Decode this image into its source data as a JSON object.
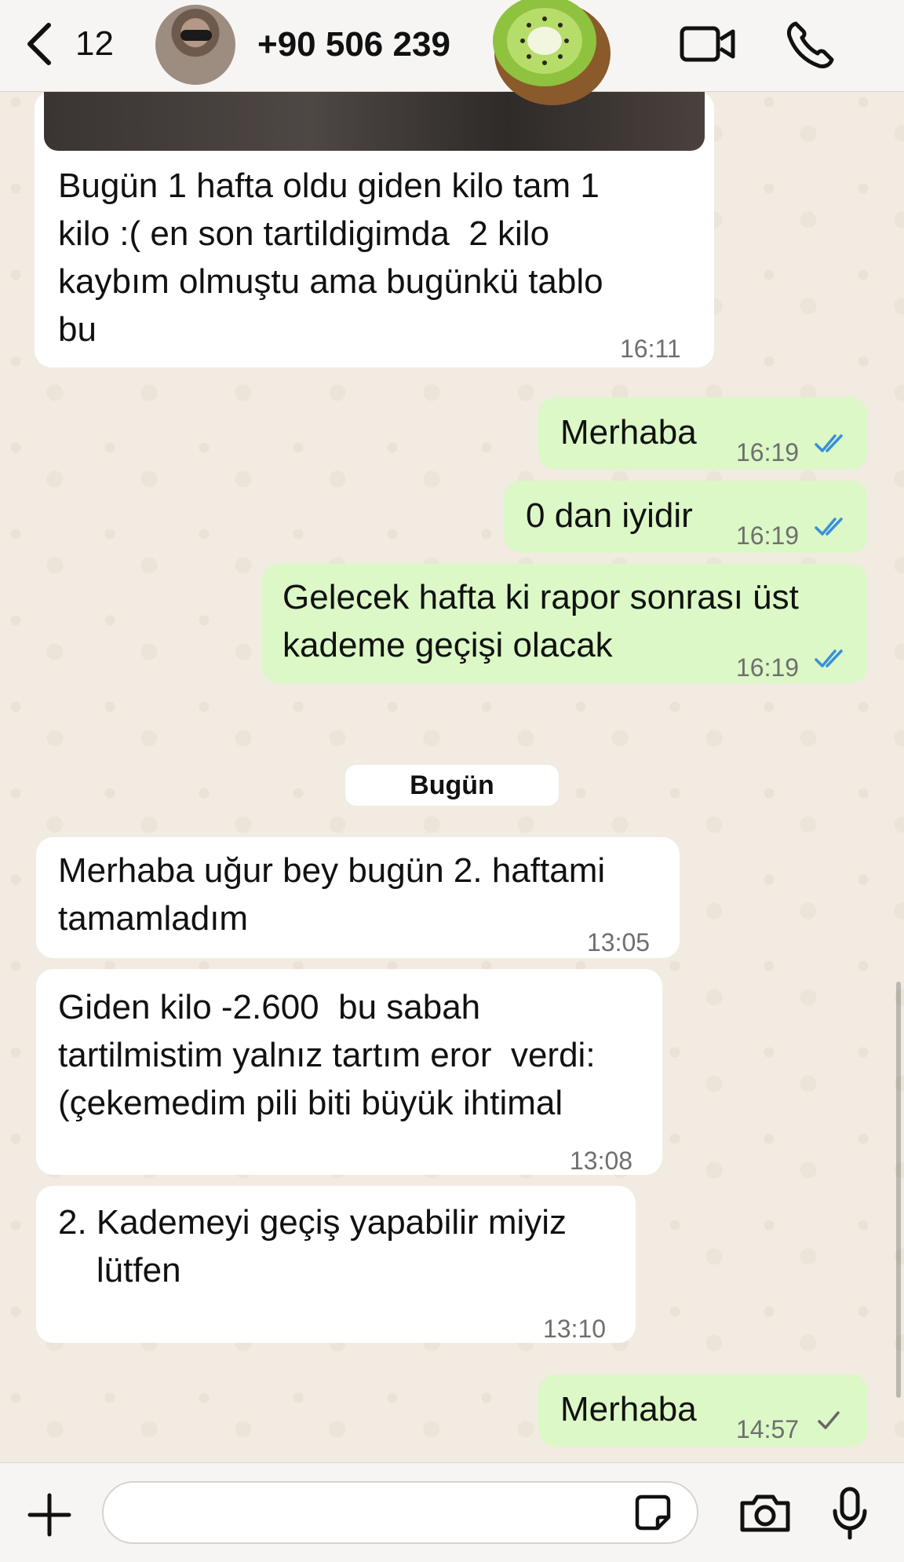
{
  "header": {
    "back_count": "12",
    "contact_name": "+90 506 239"
  },
  "messages": [
    {
      "direction": "in",
      "text": "Bugün 1 hafta oldu giden kilo tam 1\nkilo :( en son tartildigimda  2 kilo\nkaybım olmuştu ama bugünkü tablo\nbu",
      "time": "16:11"
    },
    {
      "direction": "out",
      "text": "Merhaba",
      "time": "16:19",
      "status": "read"
    },
    {
      "direction": "out",
      "text": "0 dan iyidir",
      "time": "16:19",
      "status": "read"
    },
    {
      "direction": "out",
      "text": "Gelecek hafta ki rapor sonrası üst\nkademe geçişi olacak",
      "time": "16:19",
      "status": "read"
    },
    {
      "direction": "in",
      "text": "Merhaba uğur bey bugün 2. haftami\ntamamladım",
      "time": "13:05"
    },
    {
      "direction": "in",
      "text": "Giden kilo -2.600  bu sabah\ntartilmistim yalnız tartım eror  verdi:\n(çekemedim pili biti büyük ihtimal",
      "time": "13:08"
    },
    {
      "direction": "in",
      "text": "2. Kademeyi geçiş yapabilir miyiz\n    lütfen",
      "time": "13:10"
    },
    {
      "direction": "out",
      "text": "Merhaba",
      "time": "14:57",
      "status": "sent"
    }
  ],
  "date_separator": "Bugün",
  "colors": {
    "outgoing_bubble": "#dbf8c6",
    "incoming_bubble": "#ffffff",
    "read_tick": "#3a8fdc",
    "sent_tick": "#666666"
  },
  "icons": [
    "back-icon",
    "video-icon",
    "phone-icon",
    "plus-icon",
    "sticker-icon",
    "camera-icon",
    "mic-icon"
  ]
}
